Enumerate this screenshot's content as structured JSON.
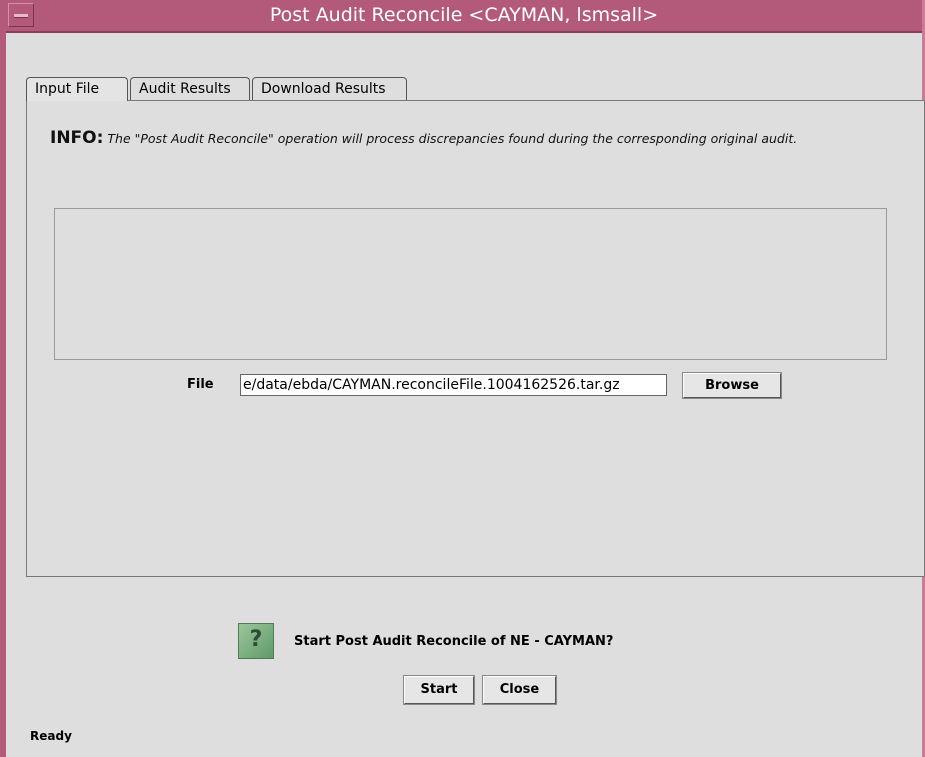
{
  "window": {
    "title": "Post Audit Reconcile <CAYMAN, lsmsall>"
  },
  "tabs": [
    {
      "label": "Input File",
      "active": true
    },
    {
      "label": "Audit Results",
      "active": false
    },
    {
      "label": "Download Results",
      "active": false
    }
  ],
  "info": {
    "label": "INFO:",
    "text": "The \"Post Audit Reconcile\" operation will process discrepancies found during the corresponding original audit."
  },
  "file": {
    "label": "File",
    "value": "e/data/ebda/CAYMAN.reconcileFile.1004162526.tar.gz",
    "browse_label": "Browse"
  },
  "confirm": {
    "icon": "question-icon",
    "question": "Start Post Audit Reconcile of NE - CAYMAN?",
    "start_label": "Start",
    "close_label": "Close"
  },
  "status": {
    "text": "Ready"
  },
  "colors": {
    "titlebar": "#b35a7a",
    "background": "#dedede"
  }
}
